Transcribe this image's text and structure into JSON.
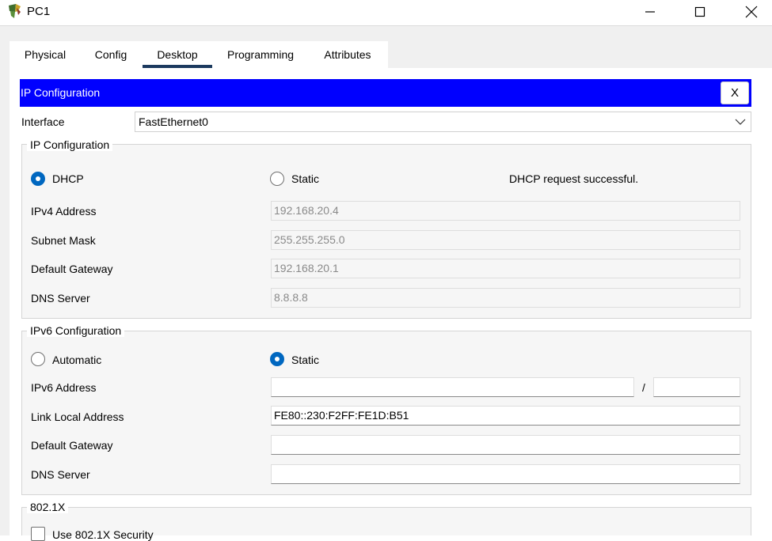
{
  "window": {
    "title": "PC1",
    "icon": "router-icon"
  },
  "tabs": [
    {
      "label": "Physical",
      "active": false
    },
    {
      "label": "Config",
      "active": false
    },
    {
      "label": "Desktop",
      "active": true
    },
    {
      "label": "Programming",
      "active": false
    },
    {
      "label": "Attributes",
      "active": false
    }
  ],
  "header": {
    "title": "IP Configuration",
    "close_label": "X",
    "color": "#0000ff"
  },
  "interface": {
    "label": "Interface",
    "value": "FastEthernet0"
  },
  "ipv4": {
    "group_title": "IP Configuration",
    "dhcp_label": "DHCP",
    "static_label": "Static",
    "mode": "DHCP",
    "status": "DHCP request successful.",
    "fields": [
      {
        "label": "IPv4 Address",
        "value": "192.168.20.4"
      },
      {
        "label": "Subnet Mask",
        "value": "255.255.255.0"
      },
      {
        "label": "Default Gateway",
        "value": "192.168.20.1"
      },
      {
        "label": "DNS Server",
        "value": "8.8.8.8"
      }
    ]
  },
  "ipv6": {
    "group_title": "IPv6 Configuration",
    "automatic_label": "Automatic",
    "static_label": "Static",
    "mode": "Static",
    "address_label": "IPv6 Address",
    "address_value": "",
    "prefix_separator": "/",
    "prefix_value": "",
    "link_local_label": "Link Local Address",
    "link_local_value": "FE80::230:F2FF:FE1D:B51",
    "gateway_label": "Default Gateway",
    "gateway_value": "",
    "dns_label": "DNS Server",
    "dns_value": ""
  },
  "dot1x": {
    "group_title": "802.1X",
    "checkbox_label": "Use 802.1X Security",
    "checked": false
  }
}
